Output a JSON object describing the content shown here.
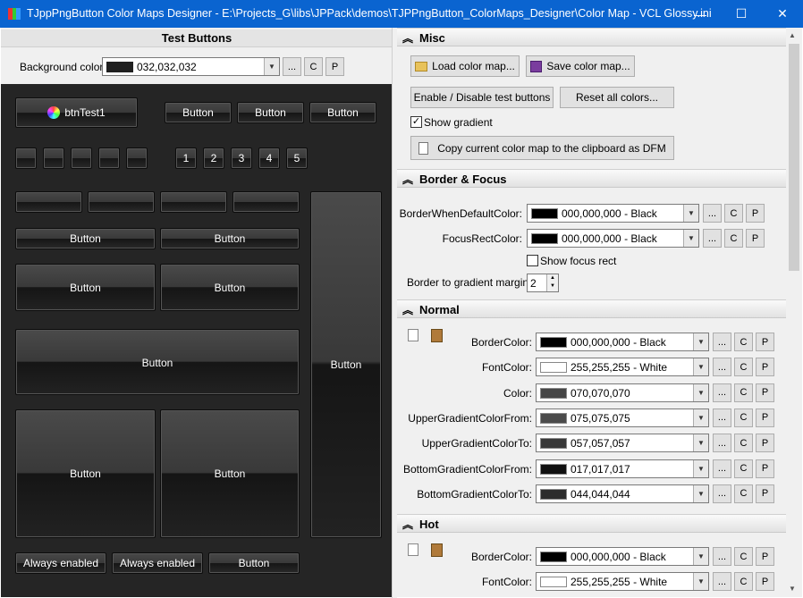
{
  "window": {
    "title": "TJppPngButton Color Maps Designer - E:\\Projects_G\\libs\\JPPack\\demos\\TJPPngButton_ColorMaps_Designer\\Color Map - VCL Glossy.ini",
    "minimize": "—",
    "maximize": "☐",
    "close": "✕"
  },
  "left": {
    "title": "Test Buttons",
    "bg_label": "Background color:",
    "bg_value": "032,032,032",
    "bg_color": "#202020",
    "more": "...",
    "c": "C",
    "p": "P",
    "btn_test": "btnTest1",
    "button": "Button",
    "numbers": [
      "1",
      "2",
      "3",
      "4",
      "5"
    ],
    "always_enabled": "Always enabled"
  },
  "misc": {
    "title": "Misc",
    "load": "Load color map...",
    "save": "Save color map...",
    "enable": "Enable / Disable test buttons",
    "reset": "Reset all colors...",
    "show_gradient": "Show gradient",
    "copy": "Copy current color map to the clipboard as DFM"
  },
  "border_focus": {
    "title": "Border & Focus",
    "rows": [
      {
        "label": "BorderWhenDefaultColor:",
        "value": "000,000,000 - Black",
        "color": "#000000"
      },
      {
        "label": "FocusRectColor:",
        "value": "000,000,000 - Black",
        "color": "#000000"
      }
    ],
    "show_focus": "Show focus rect",
    "margin_label": "Border to gradient margin:",
    "margin_value": "2"
  },
  "normal": {
    "title": "Normal",
    "rows": [
      {
        "label": "BorderColor:",
        "value": "000,000,000 - Black",
        "color": "#000000"
      },
      {
        "label": "FontColor:",
        "value": "255,255,255 - White",
        "color": "#ffffff"
      },
      {
        "label": "Color:",
        "value": "070,070,070",
        "color": "#464646"
      },
      {
        "label": "UpperGradientColorFrom:",
        "value": "075,075,075",
        "color": "#4b4b4b"
      },
      {
        "label": "UpperGradientColorTo:",
        "value": "057,057,057",
        "color": "#393939"
      },
      {
        "label": "BottomGradientColorFrom:",
        "value": "017,017,017",
        "color": "#111111"
      },
      {
        "label": "BottomGradientColorTo:",
        "value": "044,044,044",
        "color": "#2c2c2c"
      }
    ]
  },
  "hot": {
    "title": "Hot",
    "rows": [
      {
        "label": "BorderColor:",
        "value": "000,000,000 - Black",
        "color": "#000000"
      },
      {
        "label": "FontColor:",
        "value": "255,255,255 - White",
        "color": "#ffffff"
      }
    ]
  }
}
